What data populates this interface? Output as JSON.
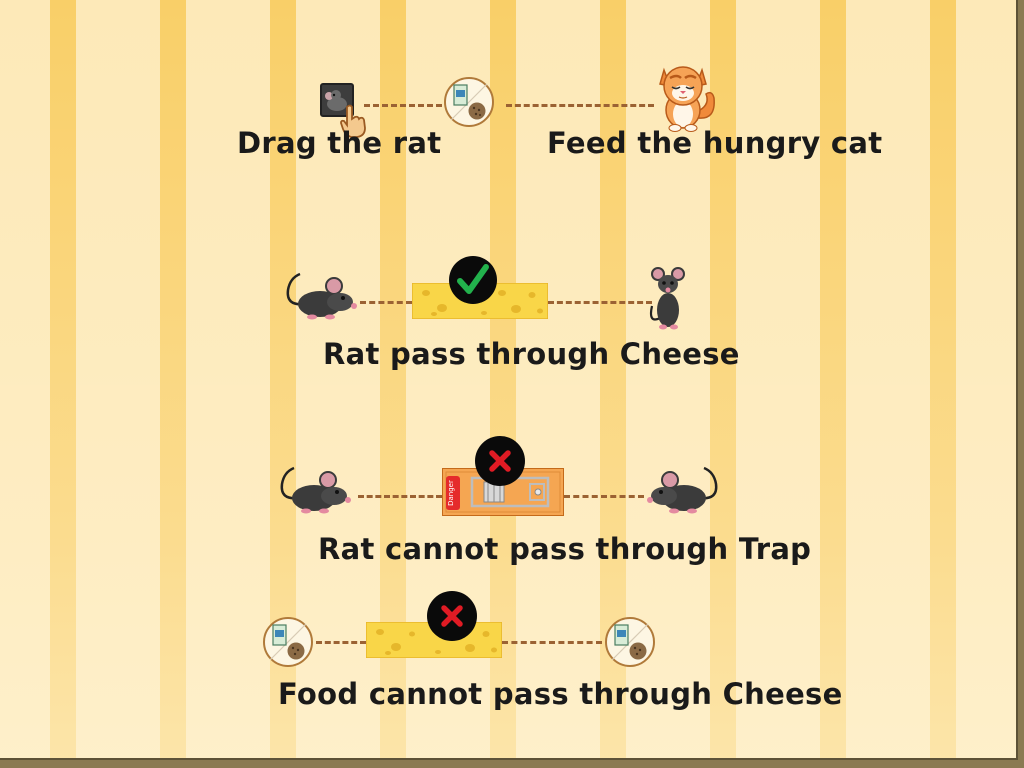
{
  "tutorial": {
    "row1": {
      "left_caption": "Drag the rat",
      "right_caption": "Feed the hungry cat"
    },
    "row2": {
      "caption": "Rat pass through Cheese",
      "status_icon": "check-icon"
    },
    "row3": {
      "caption": "Rat cannot pass through Trap",
      "status_icon": "cross-icon",
      "trap_label": "Danger"
    },
    "row4": {
      "caption": "Food cannot pass through Cheese",
      "status_icon": "cross-icon"
    }
  },
  "colors": {
    "stripe_light": "#fde9b8",
    "stripe_dark": "#f9cf68",
    "dash": "#9b6233",
    "check": "#22b14c",
    "cross": "#e01b24",
    "cheese": "#f9d648"
  }
}
